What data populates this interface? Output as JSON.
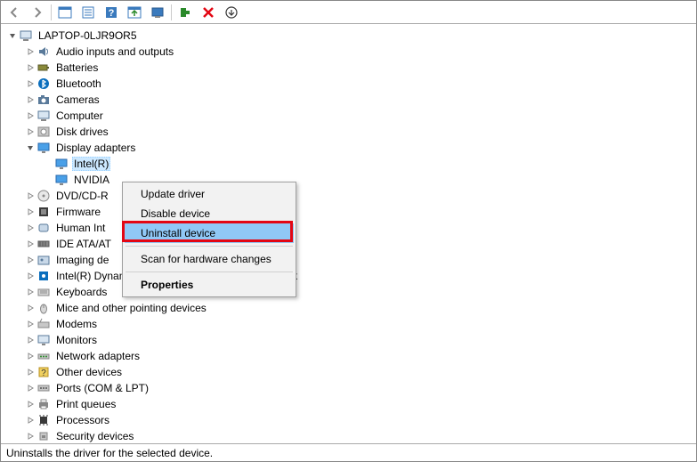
{
  "toolbar": {
    "icons": [
      "back",
      "forward",
      "|",
      "show-hidden",
      "properties",
      "help",
      "update",
      "monitor",
      "|",
      "add-legacy",
      "remove",
      "down"
    ]
  },
  "root": {
    "label": "LAPTOP-0LJR9OR5",
    "expanded": true
  },
  "categories": [
    {
      "label": "Audio inputs and outputs",
      "icon": "audio",
      "expanded": false
    },
    {
      "label": "Batteries",
      "icon": "battery",
      "expanded": false
    },
    {
      "label": "Bluetooth",
      "icon": "bluetooth",
      "expanded": false
    },
    {
      "label": "Cameras",
      "icon": "camera",
      "expanded": false
    },
    {
      "label": "Computer",
      "icon": "computer",
      "expanded": false
    },
    {
      "label": "Disk drives",
      "icon": "disk",
      "expanded": false
    },
    {
      "label": "Display adapters",
      "icon": "display",
      "expanded": true,
      "children": [
        {
          "label": "Intel(R)",
          "icon": "display",
          "selected": true
        },
        {
          "label": "NVIDIA",
          "icon": "display"
        }
      ]
    },
    {
      "label": "DVD/CD-R",
      "icon": "dvd",
      "expanded": false,
      "truncated": true
    },
    {
      "label": "Firmware",
      "icon": "firmware",
      "expanded": false
    },
    {
      "label": "Human Int",
      "icon": "hid",
      "expanded": false,
      "truncated": true
    },
    {
      "label": "IDE ATA/AT",
      "icon": "ide",
      "expanded": false,
      "truncated": true
    },
    {
      "label": "Imaging de",
      "icon": "imaging",
      "expanded": false,
      "truncated": true
    },
    {
      "label": "Intel(R) Dynamic Platform and Thermal Framework",
      "icon": "intel",
      "expanded": false
    },
    {
      "label": "Keyboards",
      "icon": "keyboard",
      "expanded": false
    },
    {
      "label": "Mice and other pointing devices",
      "icon": "mouse",
      "expanded": false
    },
    {
      "label": "Modems",
      "icon": "modem",
      "expanded": false
    },
    {
      "label": "Monitors",
      "icon": "monitor",
      "expanded": false
    },
    {
      "label": "Network adapters",
      "icon": "network",
      "expanded": false
    },
    {
      "label": "Other devices",
      "icon": "other",
      "expanded": false
    },
    {
      "label": "Ports (COM & LPT)",
      "icon": "ports",
      "expanded": false
    },
    {
      "label": "Print queues",
      "icon": "printer",
      "expanded": false
    },
    {
      "label": "Processors",
      "icon": "cpu",
      "expanded": false
    },
    {
      "label": "Security devices",
      "icon": "security",
      "expanded": false,
      "cut": true
    }
  ],
  "context_menu": {
    "items": [
      {
        "label": "Update driver"
      },
      {
        "label": "Disable device"
      },
      {
        "label": "Uninstall device",
        "hover": true,
        "highlighted": true
      },
      {
        "sep": true
      },
      {
        "label": "Scan for hardware changes"
      },
      {
        "sep": true
      },
      {
        "label": "Properties",
        "bold": true
      }
    ]
  },
  "statusbar": {
    "text": "Uninstalls the driver for the selected device."
  }
}
